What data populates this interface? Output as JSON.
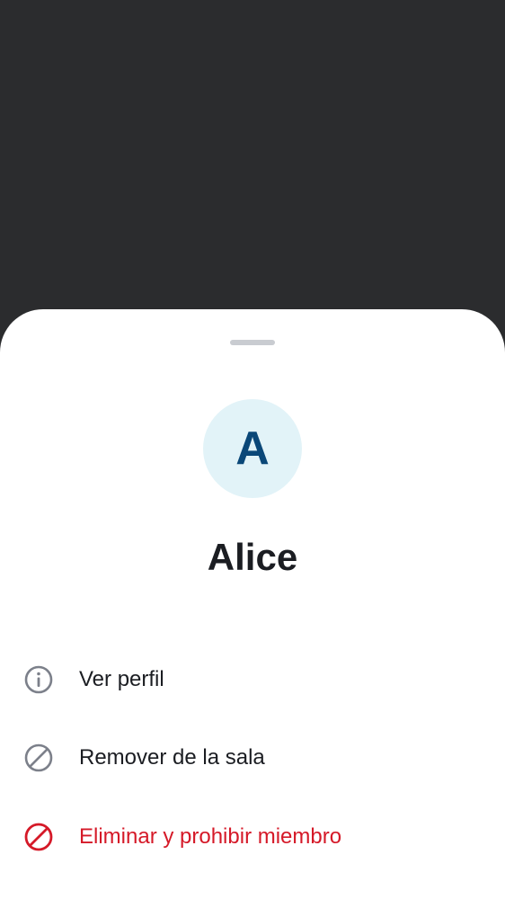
{
  "member": {
    "avatar_initial": "A",
    "name": "Alice"
  },
  "actions": [
    {
      "label": "Ver perfil",
      "icon": "info-icon"
    },
    {
      "label": "Remover de la sala",
      "icon": "block-icon"
    },
    {
      "label": "Eliminar y prohibir miembro",
      "icon": "ban-icon"
    }
  ],
  "colors": {
    "backdrop": "#2b2c2e",
    "sheet": "#ffffff",
    "avatar_bg": "#e2f3f8",
    "avatar_text": "#0a4778",
    "text_primary": "#1b1d22",
    "icon_gray": "#7c808a",
    "destructive": "#d51928"
  }
}
